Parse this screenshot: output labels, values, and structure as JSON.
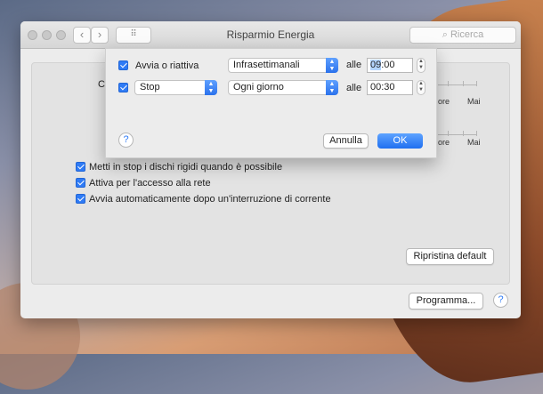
{
  "window": {
    "title": "Risparmio Energia",
    "search_placeholder": "Ricerca",
    "nav_back": "‹",
    "nav_forward": "›",
    "grid_icon": "⠿"
  },
  "panel": {
    "left_partial_label": "Co",
    "slider_labels": [
      "ore",
      "Mai",
      "ore",
      "Mai"
    ],
    "options": [
      {
        "label": "Metti in stop i dischi rigidi quando è possibile",
        "checked": true
      },
      {
        "label": "Attiva per l'accesso alla rete",
        "checked": true
      },
      {
        "label": "Avvia automaticamente dopo un'interruzione di corrente",
        "checked": true
      }
    ],
    "restore_button": "Ripristina default"
  },
  "footer": {
    "schedule_button": "Programma...",
    "help": "?"
  },
  "sheet": {
    "row1": {
      "checkbox_label": "Avvia o riattiva",
      "frequency": "Infrasettimanali",
      "at": "alle",
      "time_hours": "09",
      "time_rest": ":00"
    },
    "row2": {
      "action": "Stop",
      "frequency": "Ogni giorno",
      "at": "alle",
      "time": "00:30"
    },
    "help": "?",
    "cancel": "Annulla",
    "ok": "OK"
  },
  "colors": {
    "accent": "#2f7bf5"
  }
}
